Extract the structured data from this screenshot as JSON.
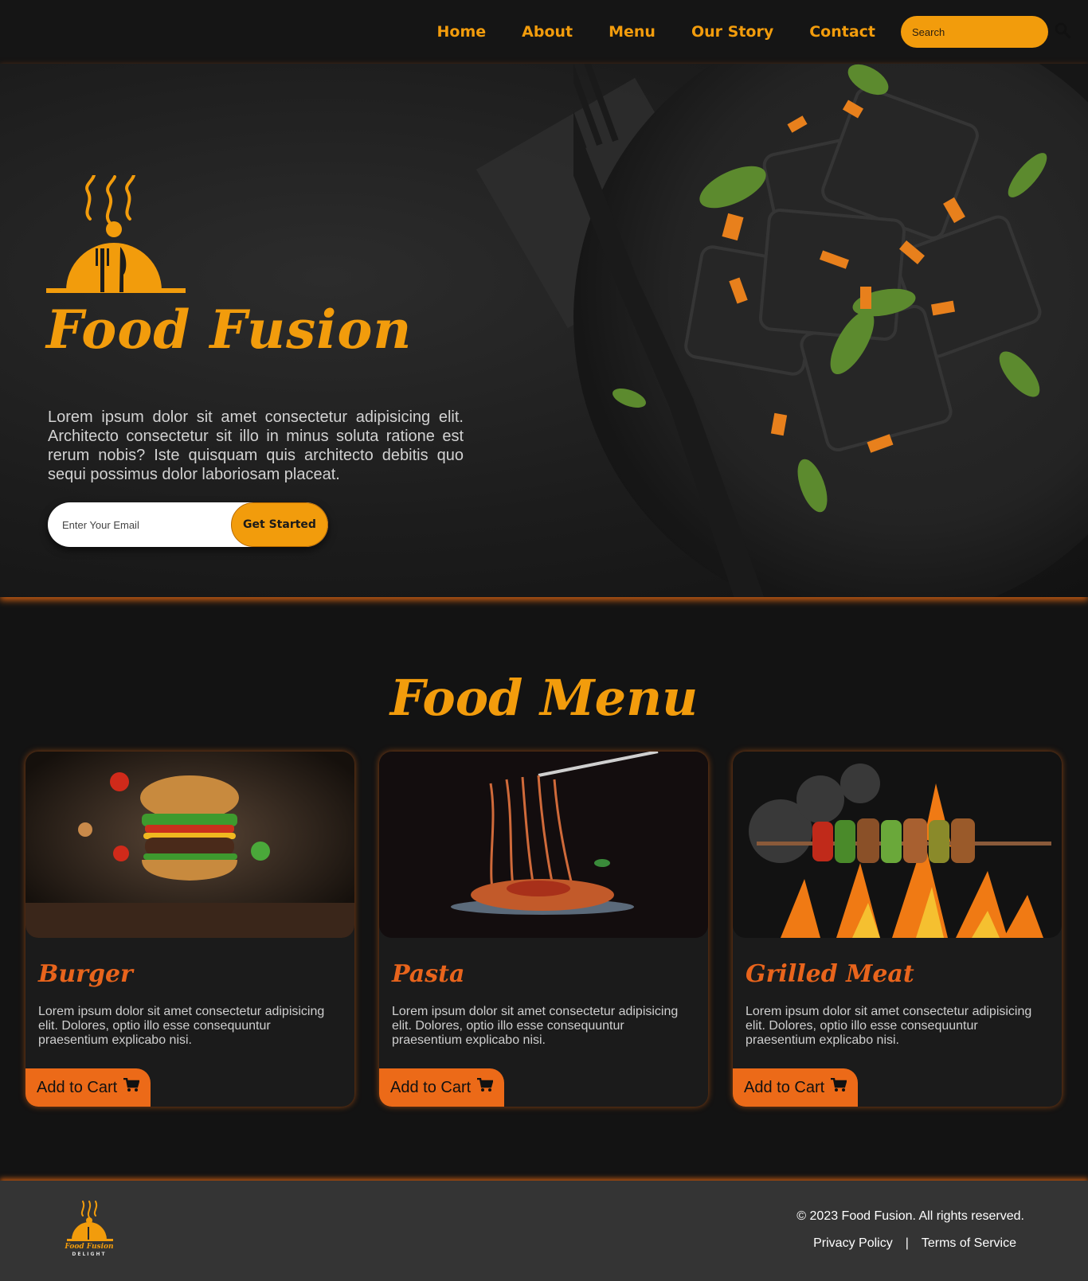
{
  "nav": {
    "links": [
      "Home",
      "About",
      "Menu",
      "Our Story",
      "Contact"
    ],
    "search_placeholder": "Search",
    "search_icon": "search-icon"
  },
  "hero": {
    "brand": "Food Fusion",
    "text": "Lorem ipsum dolor sit amet consectetur adipisicing elit. Architecto consectetur sit illo in minus soluta ratione est rerum nobis? Iste quisquam quis architecto debitis quo sequi possimus dolor laboriosam placeat.",
    "email_placeholder": "Enter Your Email",
    "cta_label": "Get Started"
  },
  "menu": {
    "title": "Food Menu",
    "items": [
      {
        "name": "Burger",
        "description": "Lorem ipsum dolor sit amet consectetur adipisicing elit. Dolores, optio illo esse consequuntur praesentium explicabo nisi.",
        "button": "Add to Cart"
      },
      {
        "name": "Pasta",
        "description": "Lorem ipsum dolor sit amet consectetur adipisicing elit. Dolores, optio illo esse consequuntur praesentium explicabo nisi.",
        "button": "Add to Cart"
      },
      {
        "name": "Grilled Meat",
        "description": "Lorem ipsum dolor sit amet consectetur adipisicing elit. Dolores, optio illo esse consequuntur praesentium explicabo nisi.",
        "button": "Add to Cart"
      }
    ]
  },
  "footer": {
    "logo_brand": "Food Fusion",
    "logo_sub": "DELIGHT",
    "copyright": "© 2023 Food Fusion. All rights reserved.",
    "privacy": "Privacy Policy",
    "separator": "|",
    "terms": "Terms of Service"
  },
  "colors": {
    "accent": "#f29c0c",
    "accent_dark": "#ec6a18",
    "background": "#131313",
    "footer": "#343434"
  }
}
